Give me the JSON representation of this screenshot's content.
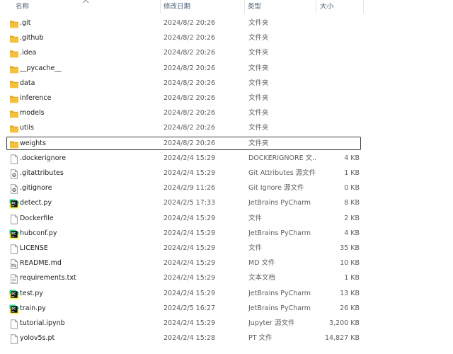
{
  "columns": {
    "name": "名称",
    "date": "修改日期",
    "type": "类型",
    "size": "大小"
  },
  "rows": [
    {
      "name": ".git",
      "date": "2024/8/2 20:26",
      "type": "文件夹",
      "size": "",
      "icon": "folder-icon"
    },
    {
      "name": ".github",
      "date": "2024/8/2 20:26",
      "type": "文件夹",
      "size": "",
      "icon": "folder-icon"
    },
    {
      "name": ".idea",
      "date": "2024/8/2 20:26",
      "type": "文件夹",
      "size": "",
      "icon": "folder-icon"
    },
    {
      "name": "__pycache__",
      "date": "2024/8/2 20:26",
      "type": "文件夹",
      "size": "",
      "icon": "folder-icon"
    },
    {
      "name": "data",
      "date": "2024/8/2 20:26",
      "type": "文件夹",
      "size": "",
      "icon": "folder-icon"
    },
    {
      "name": "inference",
      "date": "2024/8/2 20:26",
      "type": "文件夹",
      "size": "",
      "icon": "folder-icon"
    },
    {
      "name": "models",
      "date": "2024/8/2 20:26",
      "type": "文件夹",
      "size": "",
      "icon": "folder-icon"
    },
    {
      "name": "utils",
      "date": "2024/8/2 20:26",
      "type": "文件夹",
      "size": "",
      "icon": "folder-icon"
    },
    {
      "name": "weights",
      "date": "2024/8/2 20:26",
      "type": "文件夹",
      "size": "",
      "icon": "folder-icon",
      "focused": true
    },
    {
      "name": ".dockerignore",
      "date": "2024/2/4 15:29",
      "type": "DOCKERIGNORE 文...",
      "size": "4 KB",
      "icon": "blank-file-icon"
    },
    {
      "name": ".gitattributes",
      "date": "2024/2/4 15:29",
      "type": "Git Attributes 源文件",
      "size": "1 KB",
      "icon": "config-file-icon"
    },
    {
      "name": ".gitignore",
      "date": "2024/2/9 11:26",
      "type": "Git Ignore 源文件",
      "size": "0 KB",
      "icon": "config-file-icon"
    },
    {
      "name": "detect.py",
      "date": "2024/2/5 17:33",
      "type": "JetBrains PyCharm",
      "size": "8 KB",
      "icon": "pycharm-file-icon"
    },
    {
      "name": "Dockerfile",
      "date": "2024/2/4 15:29",
      "type": "文件",
      "size": "2 KB",
      "icon": "blank-file-icon"
    },
    {
      "name": "hubconf.py",
      "date": "2024/2/4 15:29",
      "type": "JetBrains PyCharm",
      "size": "4 KB",
      "icon": "pycharm-file-icon"
    },
    {
      "name": "LICENSE",
      "date": "2024/2/4 15:29",
      "type": "文件",
      "size": "35 KB",
      "icon": "blank-file-icon"
    },
    {
      "name": "README.md",
      "date": "2024/2/4 15:29",
      "type": "MD 文件",
      "size": "10 KB",
      "icon": "markdown-file-icon"
    },
    {
      "name": "requirements.txt",
      "date": "2024/2/4 15:29",
      "type": "文本文档",
      "size": "1 KB",
      "icon": "text-file-icon"
    },
    {
      "name": "test.py",
      "date": "2024/2/4 15:29",
      "type": "JetBrains PyCharm",
      "size": "13 KB",
      "icon": "pycharm-file-icon"
    },
    {
      "name": "train.py",
      "date": "2024/2/5 16:27",
      "type": "JetBrains PyCharm",
      "size": "26 KB",
      "icon": "pycharm-file-icon"
    },
    {
      "name": "tutorial.ipynb",
      "date": "2024/2/4 15:29",
      "type": "Jupyter 源文件",
      "size": "3,200 KB",
      "icon": "blank-file-icon"
    },
    {
      "name": "yolov5s.pt",
      "date": "2024/2/4 15:28",
      "type": "PT 文件",
      "size": "14,827 KB",
      "icon": "blank-file-icon"
    }
  ],
  "colors": {
    "folder": "#f5c03d",
    "folder_tab": "#e0a82a",
    "header_text": "#4c607a",
    "focus_border": "#3d3d3d",
    "pycharm_bg": "#111111",
    "pycharm_accent": "#21d789"
  }
}
